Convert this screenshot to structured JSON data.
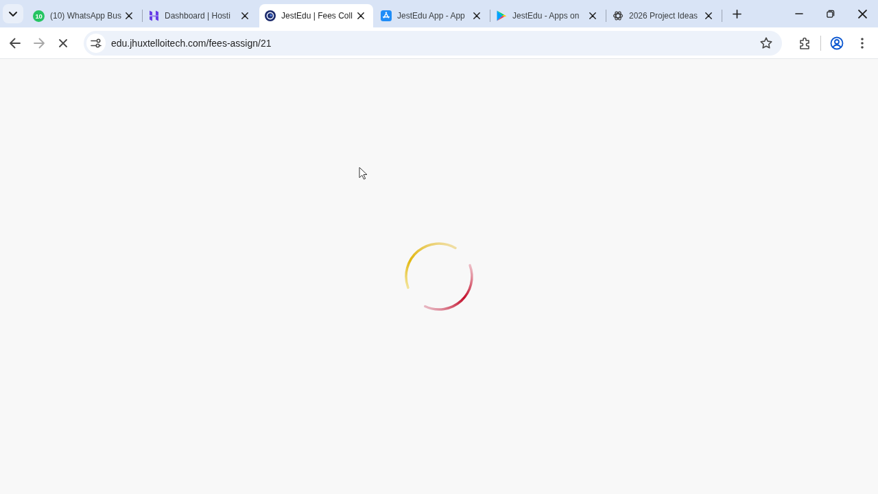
{
  "tabstrip": {
    "tabs": [
      {
        "kind": "count",
        "badge": "10",
        "title": "(10) WhatsApp Bus",
        "selected": false
      },
      {
        "kind": "h-logo",
        "title": "Dashboard | Hosti",
        "selected": false
      },
      {
        "kind": "ring-logo",
        "title": "JestEdu | Fees Coll",
        "selected": true
      },
      {
        "kind": "a-tile",
        "title": "JestEdu App - App",
        "selected": false
      },
      {
        "kind": "play",
        "title": "JestEdu - Apps on",
        "selected": false
      },
      {
        "kind": "knot",
        "title": "2026 Project Ideas",
        "selected": false
      }
    ]
  },
  "toolbar": {
    "back": {
      "disabled": false
    },
    "forward": {
      "disabled": true
    },
    "loading": true,
    "url": "edu.jhuxtelloitech.com/fees-assign/21",
    "bookmarked": false
  },
  "page": {
    "kind": "spinner"
  }
}
